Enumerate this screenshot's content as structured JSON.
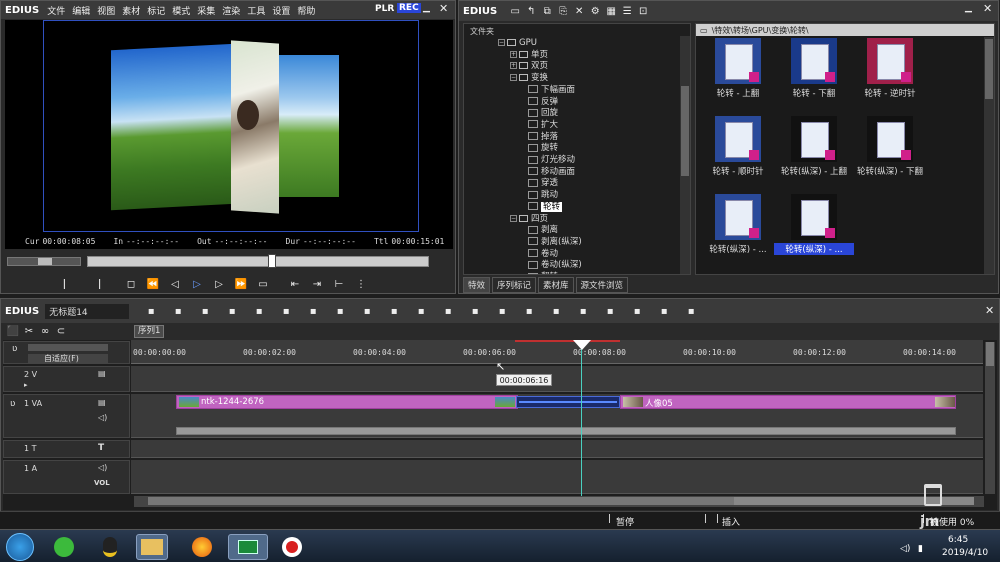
{
  "player": {
    "logo": "EDIUS",
    "menu": [
      "文件",
      "编辑",
      "视图",
      "素材",
      "标记",
      "模式",
      "采集",
      "渲染",
      "工具",
      "设置",
      "帮助"
    ],
    "mode_plr": "PLR",
    "mode_rec": "REC",
    "tc_cur_label": "Cur",
    "tc_cur": "00:00:08:05",
    "tc_in_label": "In",
    "tc_in": "--:--:--:--",
    "tc_out_label": "Out",
    "tc_out": "--:--:--:--",
    "tc_dur_label": "Dur",
    "tc_dur": "--:--:--:--",
    "tc_ttl_label": "Ttl",
    "tc_ttl": "00:00:15:01"
  },
  "bin": {
    "logo": "EDIUS",
    "folder_header": "文件夹",
    "path": "\\特效\\转场\\GPU\\变换\\轮转\\",
    "tree": {
      "gpu": "GPU",
      "single": "单页",
      "double": "双页",
      "transform": "变换",
      "items": [
        "下幅画面",
        "反弹",
        "回旋",
        "扩大",
        "掉落",
        "旋转",
        "灯光移动",
        "移动画面",
        "穿透",
        "跳动",
        "轮转"
      ],
      "four": "四页",
      "items2": [
        "剥离",
        "剥离(纵深)",
        "卷动",
        "卷动(纵深)"
      ],
      "partial": "翻转"
    },
    "thumbs": [
      "轮转 - 上翻",
      "轮转 - 下翻",
      "轮转 - 逆时针",
      "轮转 - 顺时针",
      "轮转(纵深) - 上翻",
      "轮转(纵深) - 下翻",
      "轮转(纵深) - ...",
      "轮转(纵深) - ..."
    ],
    "tabs": [
      "特效",
      "序列标记",
      "素材库",
      "源文件浏览"
    ]
  },
  "timeline": {
    "logo": "EDIUS",
    "project": "无标题14",
    "sequence_tab": "序列1",
    "fit_label": "自适应(F)",
    "ruler": [
      "00:00:00:00",
      "00:00:02:00",
      "00:00:04:00",
      "00:00:06:00",
      "00:00:08:00",
      "00:00:10:00",
      "00:00:12:00",
      "00:00:14:00"
    ],
    "tooltip": "00:00:06:16",
    "tracks": {
      "v2": "2 V",
      "va1": "1 VA",
      "t1": "1 T",
      "a1": "1 A",
      "vol": "VOL"
    },
    "clip1": "ntk-1244-2676",
    "clip2": "人像05",
    "status_pause": "暂停",
    "status_insert": "插入",
    "status_used": "被使用 0%"
  },
  "taskbar": {
    "time": "6:45",
    "date": "2019/4/10",
    "watermark": "jm"
  },
  "colors": {
    "clip": "#c064c0",
    "accent": "#3a6ad8",
    "rec": "#2a46d8",
    "playhead": "#ffffff"
  }
}
